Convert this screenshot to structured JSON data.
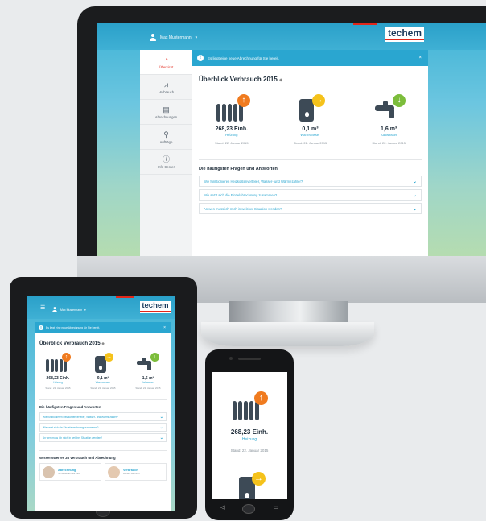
{
  "brand": {
    "logo": "techem",
    "accent": "#e1271a",
    "blue": "#2aa6d0",
    "navy": "#1a3a5c"
  },
  "user": {
    "name": "Max Mustermann",
    "caret": "▾"
  },
  "sidebar": {
    "items": [
      {
        "label": "Übersicht",
        "icon": "gauge-icon",
        "glyph": "◔"
      },
      {
        "label": "Verbrauch",
        "icon": "chart-icon",
        "glyph": "📈"
      },
      {
        "label": "Abrechnungen",
        "icon": "document-icon",
        "glyph": "▤"
      },
      {
        "label": "Aufträge",
        "icon": "wrench-icon",
        "glyph": "🔧"
      },
      {
        "label": "Info-Center",
        "icon": "info-icon",
        "glyph": "ⓘ"
      }
    ]
  },
  "notice": {
    "text": "Es liegt eine neue Abrechnung für Sie bereit.",
    "info": "!",
    "close": "×"
  },
  "overview": {
    "title": "Überblick Verbrauch 2015",
    "title_icon": "⊕",
    "cards": [
      {
        "value": "268,23 Einh.",
        "label": "Heizung",
        "date": "Stand: 22. Januar 2015",
        "badge": "↑"
      },
      {
        "value": "0,1 m³",
        "label": "Warmwasser",
        "date": "Stand: 22. Januar 2015",
        "badge": "→"
      },
      {
        "value": "1,6 m³",
        "label": "Kaltwasser",
        "date": "Stand: 22. Januar 2015",
        "badge": "↓"
      }
    ]
  },
  "faq": {
    "title": "Die häufigsten Fragen und Antworten",
    "items": [
      "Wie funktionieren Heizkostenverteiler, Wasser- und Wärmezähler?",
      "Wie setzt sich die Einzelabrechnung zusammen?",
      "An wen muss ich mich in welcher Situation wenden?"
    ],
    "chevron": "⌄"
  },
  "tablet": {
    "menu": "☰",
    "knowledge_title": "Wissenswertes zu Verbrauch und Abrechnung",
    "knowledge": [
      {
        "title": "Abrechnung",
        "sub": "So verstehen Sie Ihre"
      },
      {
        "title": "Verbrauch",
        "sub": "Lernen Sie Ihren"
      }
    ]
  },
  "phone": {
    "value": "268,23 Einh.",
    "label": "Heizung",
    "date": "Stand: 22. Januar 2015",
    "nav": [
      "◁",
      "▭"
    ]
  }
}
